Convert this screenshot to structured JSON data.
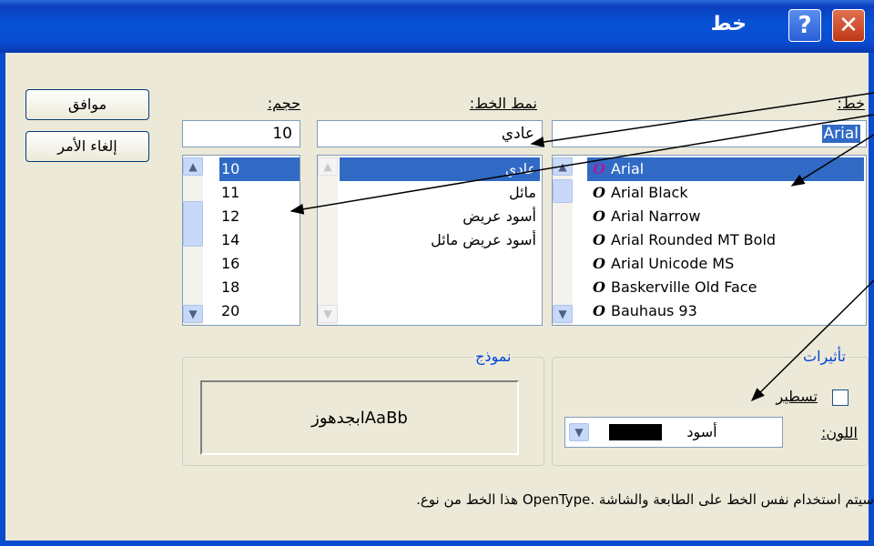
{
  "window": {
    "title": "خط",
    "help_glyph": "?",
    "close_glyph": "✕"
  },
  "buttons": {
    "ok": "موافق",
    "cancel": "إلغاء الأمر"
  },
  "font": {
    "label": "خط:",
    "value": "Arial",
    "items": [
      "Arial",
      "Arial Black",
      "Arial Narrow",
      "Arial Rounded MT Bold",
      "Arial Unicode MS",
      "Baskerville Old Face",
      "Bauhaus 93"
    ],
    "icon_glyph": "O"
  },
  "style": {
    "label": "نمط الخط:",
    "value": "عادي",
    "items": [
      "عادي",
      "مائل",
      "أسود عريض",
      "أسود عريض مائل"
    ]
  },
  "size": {
    "label": "حجم:",
    "value": "10",
    "items": [
      "10",
      "11",
      "12",
      "14",
      "16",
      "18",
      "20"
    ]
  },
  "effects": {
    "title": "تأثيرات",
    "strikeout_label": "تسطير",
    "strikeout_checked": false,
    "color_label": "اللون:",
    "color_value": "أسود",
    "color_swatch": "#000000"
  },
  "sample": {
    "title": "نموذج",
    "text": "ابجدهوزAaBb"
  },
  "note": "سيتم استخدام نفس الخط على الطابعة والشاشة .OpenType هذا الخط من نوع.",
  "colors": {
    "titlebar": "#0a4cd0",
    "selection": "#316ac5",
    "group_title": "#0046d5",
    "dialog_bg": "#ece9d8"
  }
}
